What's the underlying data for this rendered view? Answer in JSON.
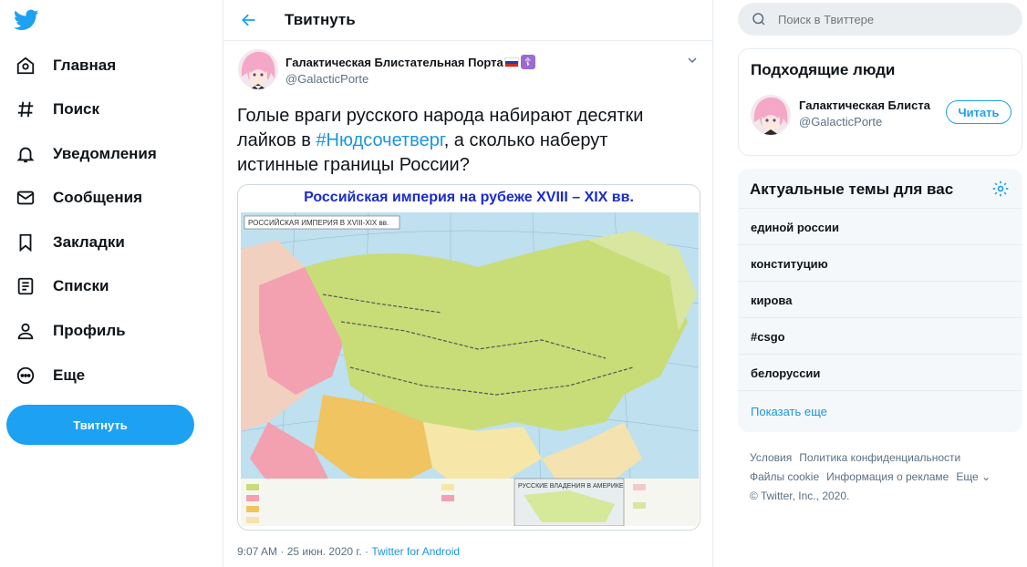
{
  "nav": {
    "items": [
      {
        "label": "Главная",
        "icon": "home-icon"
      },
      {
        "label": "Поиск",
        "icon": "hashtag-icon"
      },
      {
        "label": "Уведомления",
        "icon": "bell-icon"
      },
      {
        "label": "Сообщения",
        "icon": "envelope-icon"
      },
      {
        "label": "Закладки",
        "icon": "bookmark-icon"
      },
      {
        "label": "Списки",
        "icon": "list-icon"
      },
      {
        "label": "Профиль",
        "icon": "person-icon"
      },
      {
        "label": "Еще",
        "icon": "more-circle-icon"
      }
    ],
    "tweet_button": "Твитнуть"
  },
  "header": {
    "title": "Твитнуть"
  },
  "tweet": {
    "author_name": "Галактическая Блистательная Порта",
    "author_handle": "@GalacticPorte",
    "text_before": "Голые враги русского народа набирают десятки лайков в ",
    "hashtag": "#Нюдсочетверг",
    "text_after": ", а сколько наберут истинные границы России?",
    "media_title": "Российская империя на рубеже XVIII – XIX вв.",
    "media_subtitle": "РОССИЙСКАЯ ИМПЕРИЯ В XVIII-XIX вв.",
    "media_inset": "РУССКИЕ ВЛАДЕНИЯ В АМЕРИКЕ",
    "time": "9:07 AM",
    "date": "25 июн. 2020 г.",
    "source": "Twitter for Android"
  },
  "search": {
    "placeholder": "Поиск в Твиттере"
  },
  "who_to_follow": {
    "title": "Подходящие люди",
    "name": "Галактическая Блиста",
    "handle": "@GalacticPorte",
    "follow_label": "Читать"
  },
  "trends": {
    "title": "Актуальные темы для вас",
    "items": [
      "единой россии",
      "конституцию",
      "кирова",
      "#csgo",
      "белоруссии"
    ],
    "show_more": "Показать еще"
  },
  "footer": {
    "terms": "Условия",
    "privacy": "Политика конфиденциальности",
    "cookies": "Файлы cookie",
    "ads": "Информация о рекламе",
    "more": "Еще",
    "copyright": "© Twitter, Inc., 2020."
  },
  "colors": {
    "accent": "#1da1f2",
    "link": "#1b95e0",
    "muted": "#5b7083"
  }
}
